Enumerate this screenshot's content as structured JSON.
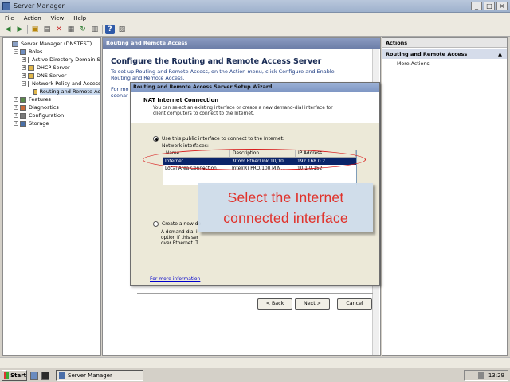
{
  "window": {
    "title": "Server Manager",
    "buttons": [
      "_",
      "□",
      "×"
    ]
  },
  "menu": [
    "File",
    "Action",
    "View",
    "Help"
  ],
  "tree": [
    {
      "label": "Server Manager (DNSTEST)",
      "indent": 0,
      "exp": "",
      "icon": "server"
    },
    {
      "label": "Roles",
      "indent": 1,
      "exp": "−",
      "icon": "roles"
    },
    {
      "label": "Active Directory Domain Se",
      "indent": 2,
      "exp": "+",
      "icon": "role"
    },
    {
      "label": "DHCP Server",
      "indent": 2,
      "exp": "+",
      "icon": "role"
    },
    {
      "label": "DNS Server",
      "indent": 2,
      "exp": "+",
      "icon": "role"
    },
    {
      "label": "Network Policy and Access",
      "indent": 2,
      "exp": "−",
      "icon": "role"
    },
    {
      "label": "Routing and Remote Ac",
      "indent": 3,
      "exp": "",
      "icon": "role",
      "selected": true
    },
    {
      "label": "Features",
      "indent": 1,
      "exp": "+",
      "icon": "feat"
    },
    {
      "label": "Diagnostics",
      "indent": 1,
      "exp": "+",
      "icon": "diag"
    },
    {
      "label": "Configuration",
      "indent": 1,
      "exp": "+",
      "icon": "conf"
    },
    {
      "label": "Storage",
      "indent": 1,
      "exp": "+",
      "icon": "stor"
    }
  ],
  "center": {
    "header": "Routing and Remote Access",
    "title": "Configure the Routing and Remote Access Server",
    "para1a": "To set up Routing and Remote Access, on the Action menu, click Configure and Enable",
    "para1b": "Routing and Remote Access.",
    "para2a": "For mo",
    "para2b": "scenar"
  },
  "actions": {
    "header": "Actions",
    "sub": "Routing and Remote Access",
    "item": "More Actions"
  },
  "wizard": {
    "title": "Routing and Remote Access Server Setup Wizard",
    "heading": "NAT Internet Connection",
    "desc": "You can select an existing interface or create a new demand-dial interface for client computers to connect to the Internet.",
    "opt1": "Use this public interface to connect to the Internet:",
    "net_label": "Network interfaces:",
    "columns": [
      "Name",
      "Description",
      "IP Address"
    ],
    "rows": [
      [
        "Internet",
        "3Com EtherLink 10/10...",
        "192.168.0.2"
      ],
      [
        "Local Area Connection",
        "Intel(R) PRO/100 M N...",
        "10.1.0.152"
      ]
    ],
    "opt2": "Create a new de",
    "opt2_desc": [
      "A demand-dial i",
      "option if this ser",
      "over Ethernet. T"
    ],
    "info_link": "For more information",
    "buttons": {
      "back": "< Back",
      "next": "Next >",
      "cancel": "Cancel"
    }
  },
  "callout": {
    "line1": "Select the Internet",
    "line2": "connected interface"
  },
  "taskbar": {
    "start": "Start",
    "task": "Server Manager",
    "clock": "13:29"
  },
  "colors": {
    "callout_text": "#e0322b",
    "oval": "#d81c1c",
    "selection": "#0a246a"
  }
}
